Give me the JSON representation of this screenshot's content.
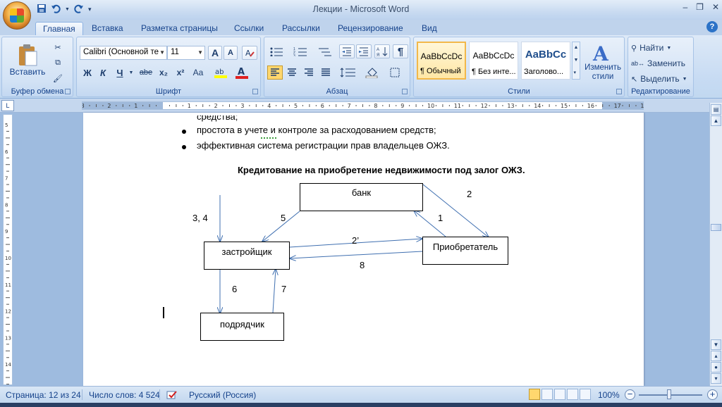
{
  "window": {
    "title": "Лекции - Microsoft Word",
    "controls": [
      "–",
      "❐",
      "✕"
    ]
  },
  "tabs": [
    "Главная",
    "Вставка",
    "Разметка страницы",
    "Ссылки",
    "Рассылки",
    "Рецензирование",
    "Вид"
  ],
  "ribbon": {
    "clipboard": {
      "label": "Буфер обмена",
      "paste": "Вставить"
    },
    "font": {
      "label": "Шрифт",
      "font_name": "Calibri (Основной те",
      "font_size": "11",
      "grow": "A",
      "shrink": "A",
      "bold": "Ж",
      "italic": "К",
      "underline": "Ч",
      "strike": "abe",
      "subscript": "x₂",
      "superscript": "x²",
      "case": "Aa"
    },
    "paragraph": {
      "label": "Абзац",
      "pilcrow": "¶"
    },
    "styles": {
      "label": "Стили",
      "tiles": [
        {
          "sample": "AaBbCcDc",
          "name": "¶ Обычный"
        },
        {
          "sample": "AaBbCcDc",
          "name": "¶ Без инте..."
        },
        {
          "sample": "AaBbCc",
          "name": "Заголово..."
        }
      ],
      "change": "Изменить стили"
    },
    "editing": {
      "label": "Редактирование",
      "find": "Найти",
      "replace": "Заменить",
      "select": "Выделить"
    }
  },
  "document": {
    "cut_line": "средства;",
    "bullets": [
      "простота в учете и контроле за расходованием средств;",
      "эффективная система регистрации прав владельцев ОЖЗ."
    ],
    "heading": "Кредитование на приобретение недвижимости под залог ОЖЗ.",
    "diagram": {
      "nodes": {
        "bank": "банк",
        "developer": "застройщик",
        "buyer": "Приобретатель",
        "contractor": "подрядчик"
      },
      "labels": [
        "2",
        "3, 4",
        "5",
        "1",
        "2’",
        "8",
        "6",
        "7"
      ]
    }
  },
  "status": {
    "page": "Страница: 12 из 24",
    "words": "Число слов: 4 524",
    "language": "Русский (Россия)",
    "zoom": "100%"
  },
  "colors": {
    "ribbon_bg": "#c7dbf3",
    "doc_bg": "#9ebbdf",
    "accent": "#15428b"
  }
}
